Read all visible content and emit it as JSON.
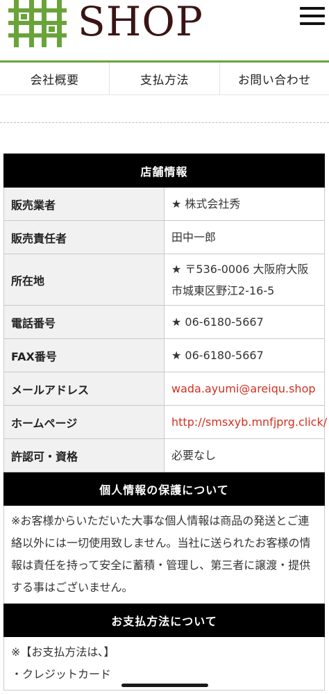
{
  "header": {
    "logo_text": "SHOP",
    "brand_color": "#6aa33a",
    "menu_icon": "hamburger-menu-icon"
  },
  "nav": {
    "items": [
      {
        "label": "会社概要"
      },
      {
        "label": "支払方法"
      },
      {
        "label": "お問い合わせ"
      }
    ]
  },
  "store_info": {
    "title": "店舗情報",
    "rows": [
      {
        "label": "販売業者",
        "value": "★ 株式会社秀"
      },
      {
        "label": "販売責任者",
        "value": "田中一郎"
      },
      {
        "label": "所在地",
        "value": "★ 〒536-0006 大阪府大阪市城東区野江2-16-5"
      },
      {
        "label": "電話番号",
        "value": "★ 06-6180-5667"
      },
      {
        "label": "FAX番号",
        "value": "★ 06-6180-5667"
      },
      {
        "label": "メールアドレス",
        "value": "wada.ayumi@areiqu.shop"
      },
      {
        "label": "ホームページ",
        "value": "http://smsxyb.mnfjprg.click/"
      },
      {
        "label": "許認可・資格",
        "value": "必要なし"
      }
    ]
  },
  "privacy": {
    "title": "個人情報の保護について",
    "text": "※お客様からいただいた大事な個人情報は商品の発送とご連絡以外には一切使用致しません。当社に送られたお客様の情報は責任を持って安全に蓄積・管理し、第三者に譲渡・提供する事はございません。"
  },
  "payment": {
    "title": "お支払方法について",
    "line1": "※【お支払方法は､】",
    "line2": "・クレジットカード"
  },
  "colors": {
    "link": "#d2301f",
    "section_bg": "#000000",
    "label_bg": "#f1f1f1"
  }
}
